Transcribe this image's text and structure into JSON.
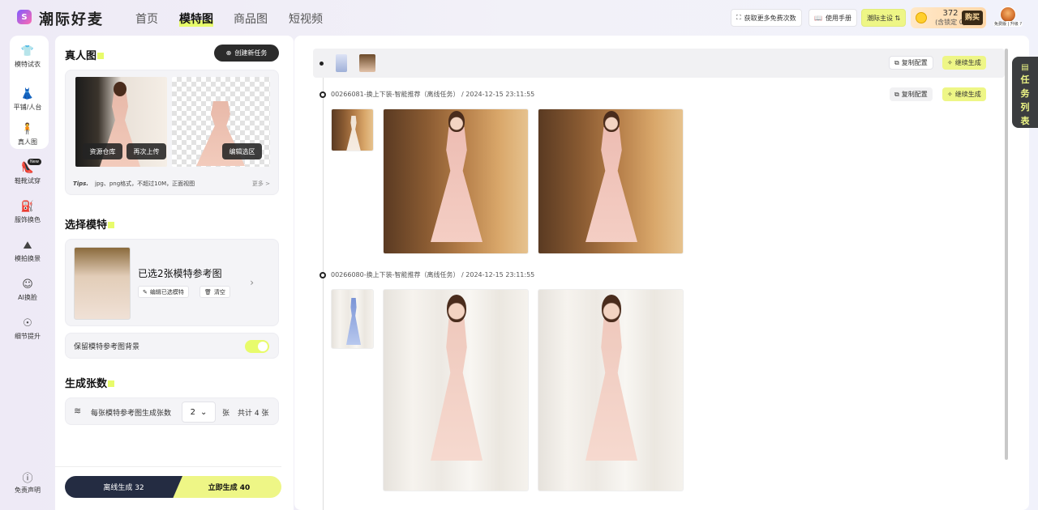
{
  "app": {
    "logo_glyph": "S",
    "brand": "潮际好麦"
  },
  "nav": [
    {
      "label": "首页",
      "active": false
    },
    {
      "label": "模特图",
      "active": true
    },
    {
      "label": "商品图",
      "active": false
    },
    {
      "label": "短视频",
      "active": false
    }
  ],
  "topbar": {
    "free_times": "获取更多免费次数",
    "manual": "使用手册",
    "theme": "潮际主设 ⇅",
    "credits": "372",
    "locked": "(含锁定 0)",
    "buy": "购买",
    "avatar_label": "免费版 | 升级 ?"
  },
  "sidebar": [
    {
      "label": "模特试衣",
      "icon": "shirt-icon",
      "glyph": "👕"
    },
    {
      "label": "平铺/人台",
      "icon": "dress-form-icon",
      "glyph": "👗"
    },
    {
      "label": "真人图",
      "icon": "person-icon",
      "glyph": "🧍"
    },
    {
      "label": "鞋靴试穿",
      "icon": "shoe-icon",
      "glyph": "👠",
      "badge": "New"
    },
    {
      "label": "服饰换色",
      "icon": "paint-bucket-icon",
      "glyph": "⛽"
    },
    {
      "label": "模拍换景",
      "icon": "scene-icon",
      "glyph": "⛰"
    },
    {
      "label": "AI换脸",
      "icon": "face-icon",
      "glyph": "☺"
    },
    {
      "label": "细节提升",
      "icon": "enhance-icon",
      "glyph": "☉"
    },
    {
      "label": "免责声明",
      "icon": "info-icon",
      "glyph": "ⓘ"
    }
  ],
  "panel": {
    "real_title": "真人图",
    "create_task": "创建新任务",
    "asset_library": "资源仓库",
    "reupload": "再次上传",
    "edit_selection": "编辑选区",
    "tips_label": "Tips.",
    "tips_text": "jpg、png格式，不超过10M，正面视图",
    "more": "更多 >",
    "model_title": "选择模特",
    "selected_text": "已选2张模特参考图",
    "edit_models": "编辑已选模特",
    "clear": "清空",
    "keep_bg": "保留模特参考图背景",
    "keep_bg_on": true,
    "count_title": "生成张数",
    "per_model_label": "每张模特参考图生成张数",
    "per_model_value": "2",
    "unit": "张",
    "total": "共计 4 张",
    "offline_gen": "离线生成 32",
    "instant_gen": "立即生成 40"
  },
  "main": {
    "copy_config": "复制配置",
    "continue_gen": "继续生成",
    "tasks": [
      {
        "title": "00266081-换上下装-智能推荐（离线任务）",
        "time": "2024-12-15 23:11:55"
      },
      {
        "title": "00266080-换上下装-智能推荐（离线任务）",
        "time": "2024-12-15 23:11:55"
      }
    ]
  },
  "task_list": [
    "任",
    "务",
    "列",
    "表"
  ],
  "colors": {
    "accent": "#e8fb6b",
    "dark": "#242c42",
    "panel_bg": "#f4f4f7"
  }
}
